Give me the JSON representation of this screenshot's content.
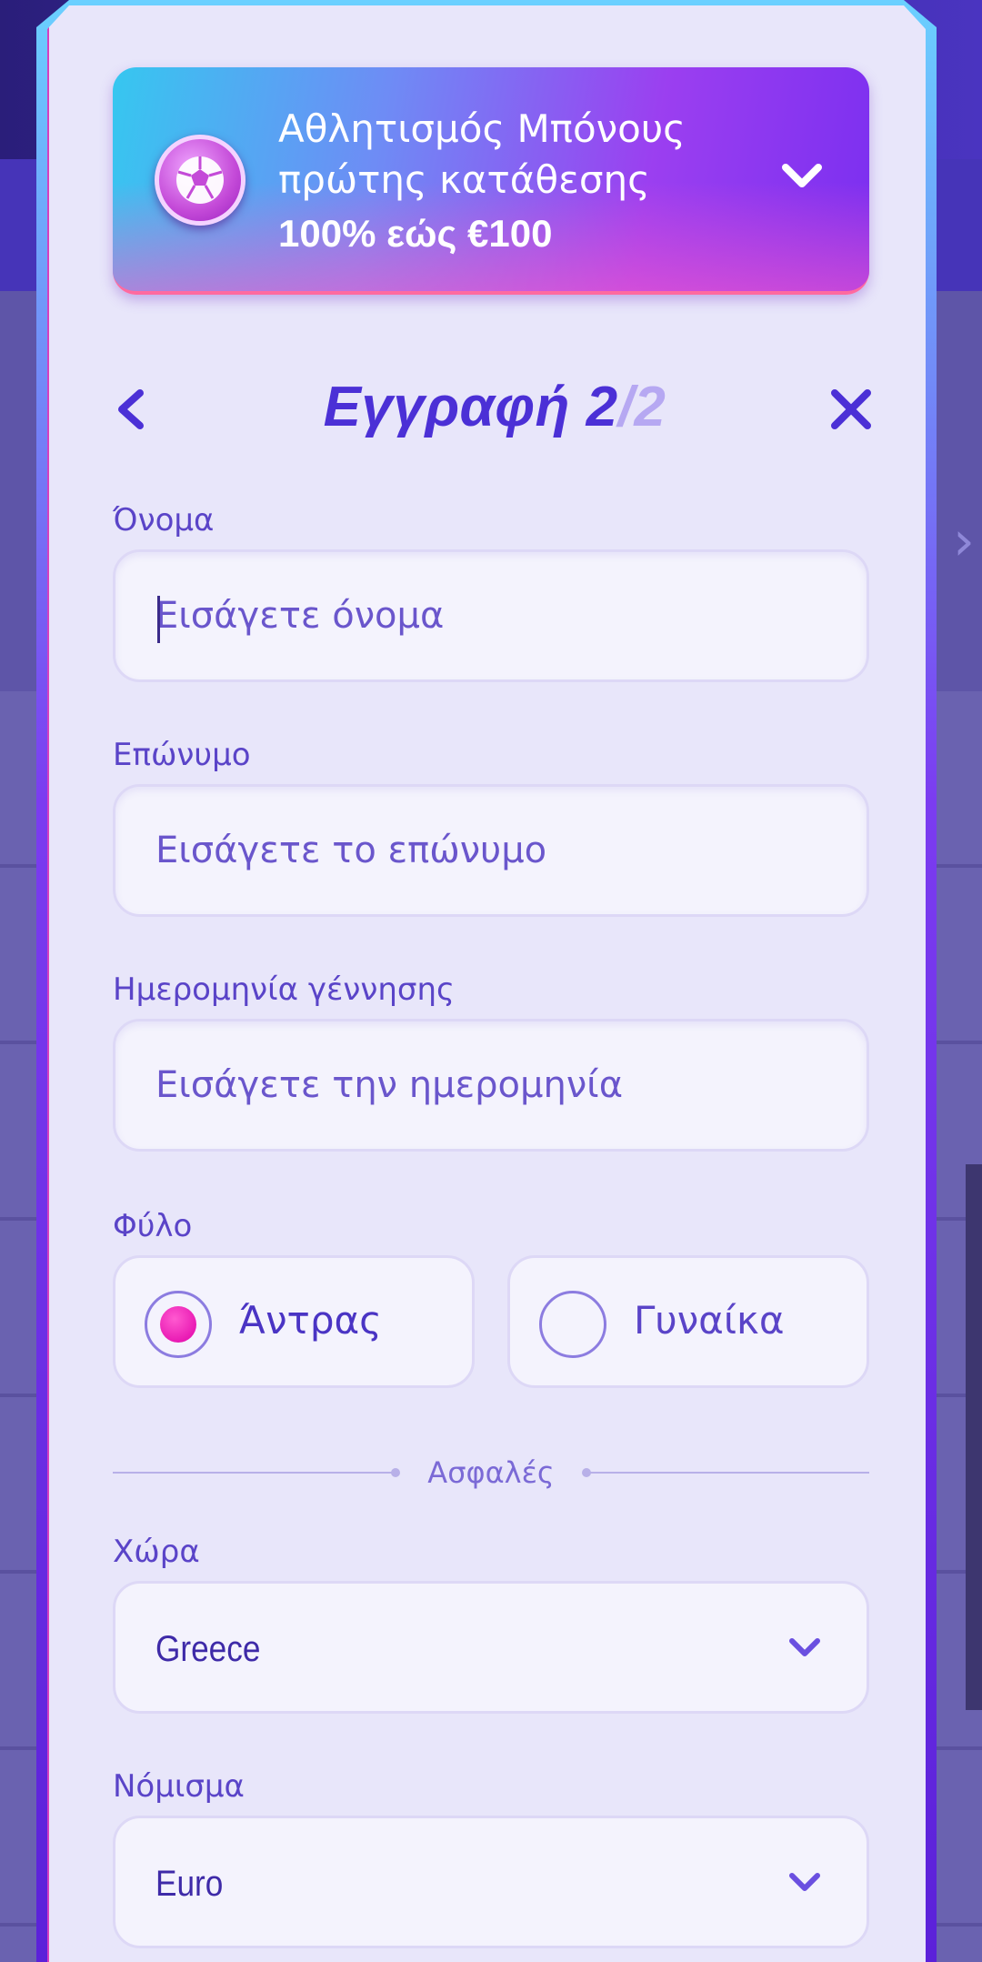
{
  "banner": {
    "title_line1": "Αθλητισμός Μπόνους",
    "title_line2": "πρώτης κατάθεσης",
    "amount": "100% εώς €100",
    "icon": "soccer-ball-icon",
    "expand_icon": "chevron-down-icon"
  },
  "header": {
    "title": "Εγγραφή 2",
    "title_total": "/2",
    "back_icon": "chevron-left-icon",
    "close_icon": "close-icon"
  },
  "form": {
    "first_name": {
      "label": "Όνομα",
      "placeholder": "Εισάγετε όνομα",
      "value": ""
    },
    "last_name": {
      "label": "Επώνυμο",
      "placeholder": "Εισάγετε το επώνυμο",
      "value": ""
    },
    "birth_date": {
      "label": "Ημερομηνία γέννησης",
      "placeholder": "Εισάγετε την ημερομηνία",
      "value": ""
    },
    "gender": {
      "label": "Φύλο",
      "options": [
        {
          "label": "Άντρας",
          "selected": true
        },
        {
          "label": "Γυναίκα",
          "selected": false
        }
      ]
    },
    "divider_text": "Ασφαλές",
    "country": {
      "label": "Χώρα",
      "value": "Greece"
    },
    "currency": {
      "label": "Νόμισμα",
      "value": "Euro"
    }
  },
  "colors": {
    "accent": "#4b30d6",
    "radio_selected": "#e000a8",
    "panel_bg": "#e8e6fa"
  }
}
